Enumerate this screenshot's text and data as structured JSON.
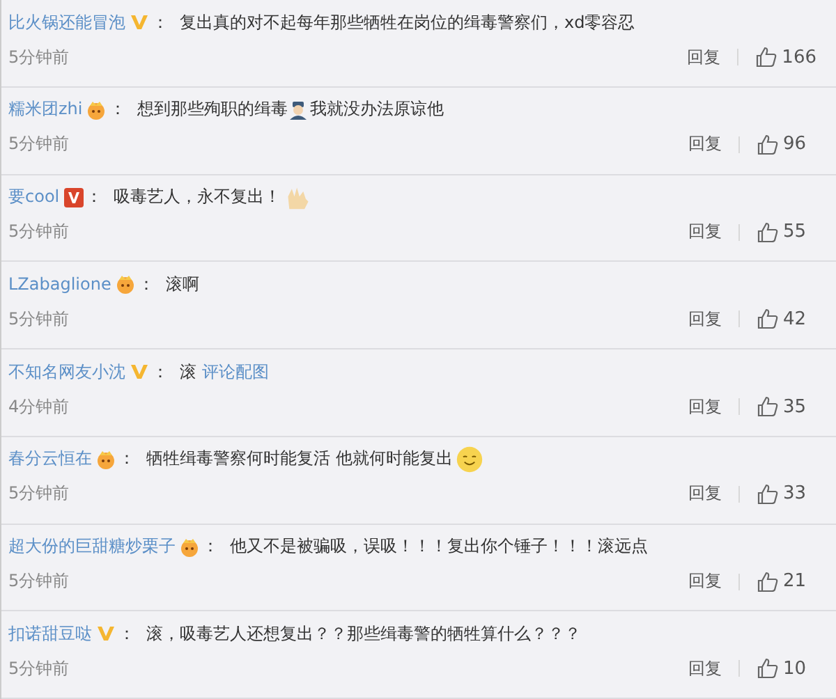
{
  "comments": [
    {
      "user": "比火锅还能冒泡",
      "badge": {
        "kind": "v_gold"
      },
      "separator": "：",
      "parts": [
        {
          "kind": "text",
          "text": "复出真的对不起每年那些牺牲在岗位的缉毒警察们，xd零容忍"
        }
      ],
      "time": "5分钟前",
      "reply": "回复",
      "likes": "166"
    },
    {
      "user": "糯米团zhi",
      "badge": {
        "kind": "crown"
      },
      "separator": "：",
      "parts": [
        {
          "kind": "text",
          "text": "想到那些殉职的缉毒"
        },
        {
          "kind": "police"
        },
        {
          "kind": "text",
          "text": "我就没办法原谅他"
        }
      ],
      "time": "5分钟前",
      "reply": "回复",
      "likes": "96"
    },
    {
      "user": "要cool",
      "badge": {
        "kind": "v_red"
      },
      "separator": "：",
      "parts": [
        {
          "kind": "text",
          "text": "吸毒艺人，永不复出！"
        },
        {
          "kind": "hands"
        }
      ],
      "time": "5分钟前",
      "reply": "回复",
      "likes": "55"
    },
    {
      "user": "LZabaglione",
      "badge": {
        "kind": "crown"
      },
      "separator": "：",
      "parts": [
        {
          "kind": "text",
          "text": "滚啊"
        }
      ],
      "time": "5分钟前",
      "reply": "回复",
      "likes": "42"
    },
    {
      "user": "不知名网友小沈",
      "badge": {
        "kind": "v_gold"
      },
      "separator": "：",
      "parts": [
        {
          "kind": "text",
          "text": "滚"
        },
        {
          "kind": "link",
          "text": "评论配图"
        }
      ],
      "time": "4分钟前",
      "reply": "回复",
      "likes": "35"
    },
    {
      "user": "春分云恒在",
      "badge": {
        "kind": "crown"
      },
      "separator": "：",
      "parts": [
        {
          "kind": "text",
          "text": "牺牲缉毒警察何时能复活 他就何时能复出"
        },
        {
          "kind": "smile"
        }
      ],
      "time": "5分钟前",
      "reply": "回复",
      "likes": "33"
    },
    {
      "user": "超大份的巨甜糖炒栗子",
      "badge": {
        "kind": "crown"
      },
      "separator": "：",
      "parts": [
        {
          "kind": "text",
          "text": "他又不是被骗吸，误吸！！！复出你个锤子！！！滚远点"
        }
      ],
      "time": "5分钟前",
      "reply": "回复",
      "likes": "21"
    },
    {
      "user": "扣诺甜豆哒",
      "badge": {
        "kind": "v_gold"
      },
      "separator": "：",
      "parts": [
        {
          "kind": "text",
          "text": "滚，吸毒艺人还想复出？？那些缉毒警的牺牲算什么？？？"
        }
      ],
      "time": "5分钟前",
      "reply": "回复",
      "likes": "10"
    }
  ]
}
